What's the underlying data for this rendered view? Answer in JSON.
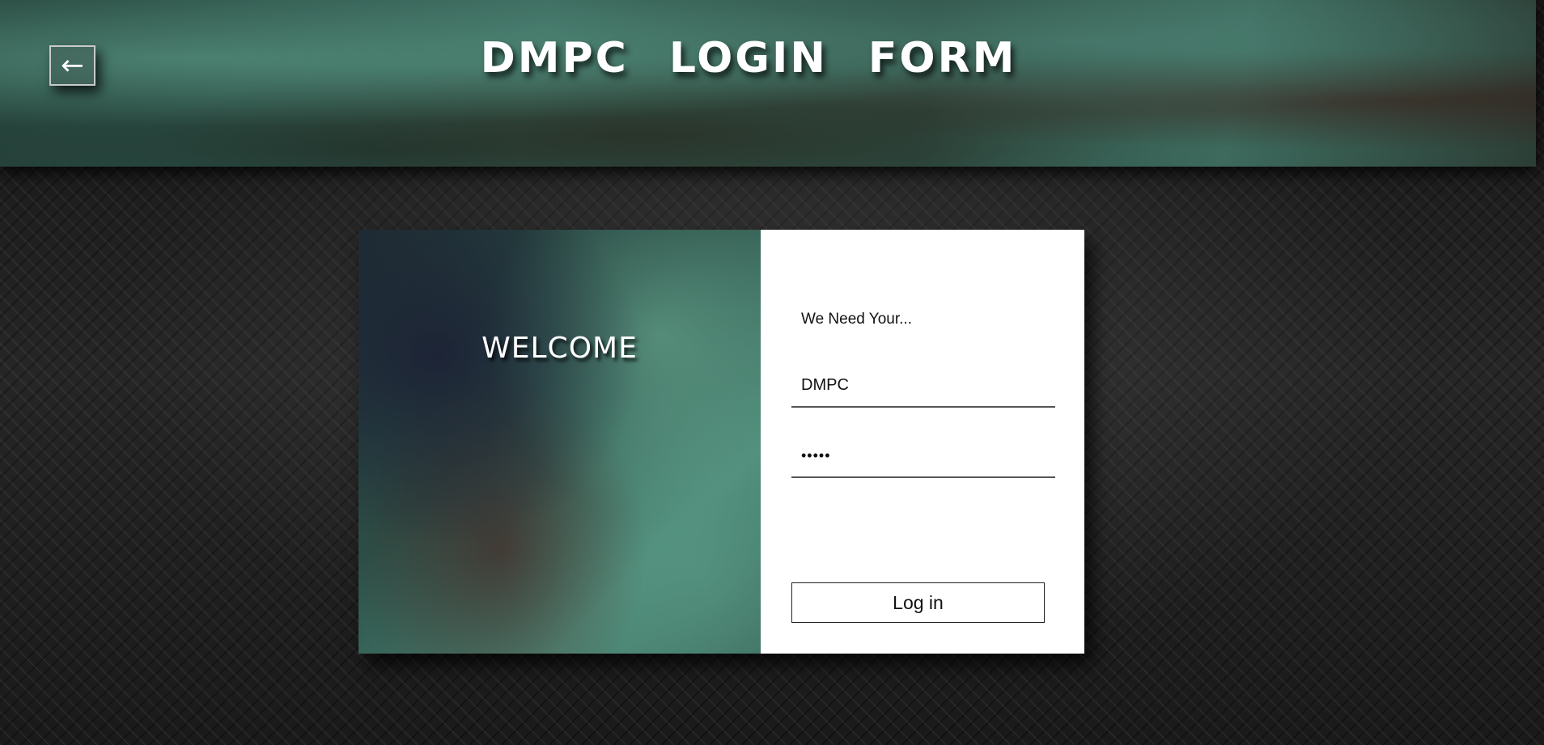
{
  "header": {
    "back_symbol": "←",
    "title_words": [
      "DMPC",
      "LOGIN",
      "FORM"
    ]
  },
  "card": {
    "welcome_text": "WELCOME",
    "prompt_text": "We Need Your...",
    "username": {
      "value": "DMPC"
    },
    "password": {
      "value": "•••••"
    },
    "login_label": "Log in"
  }
}
